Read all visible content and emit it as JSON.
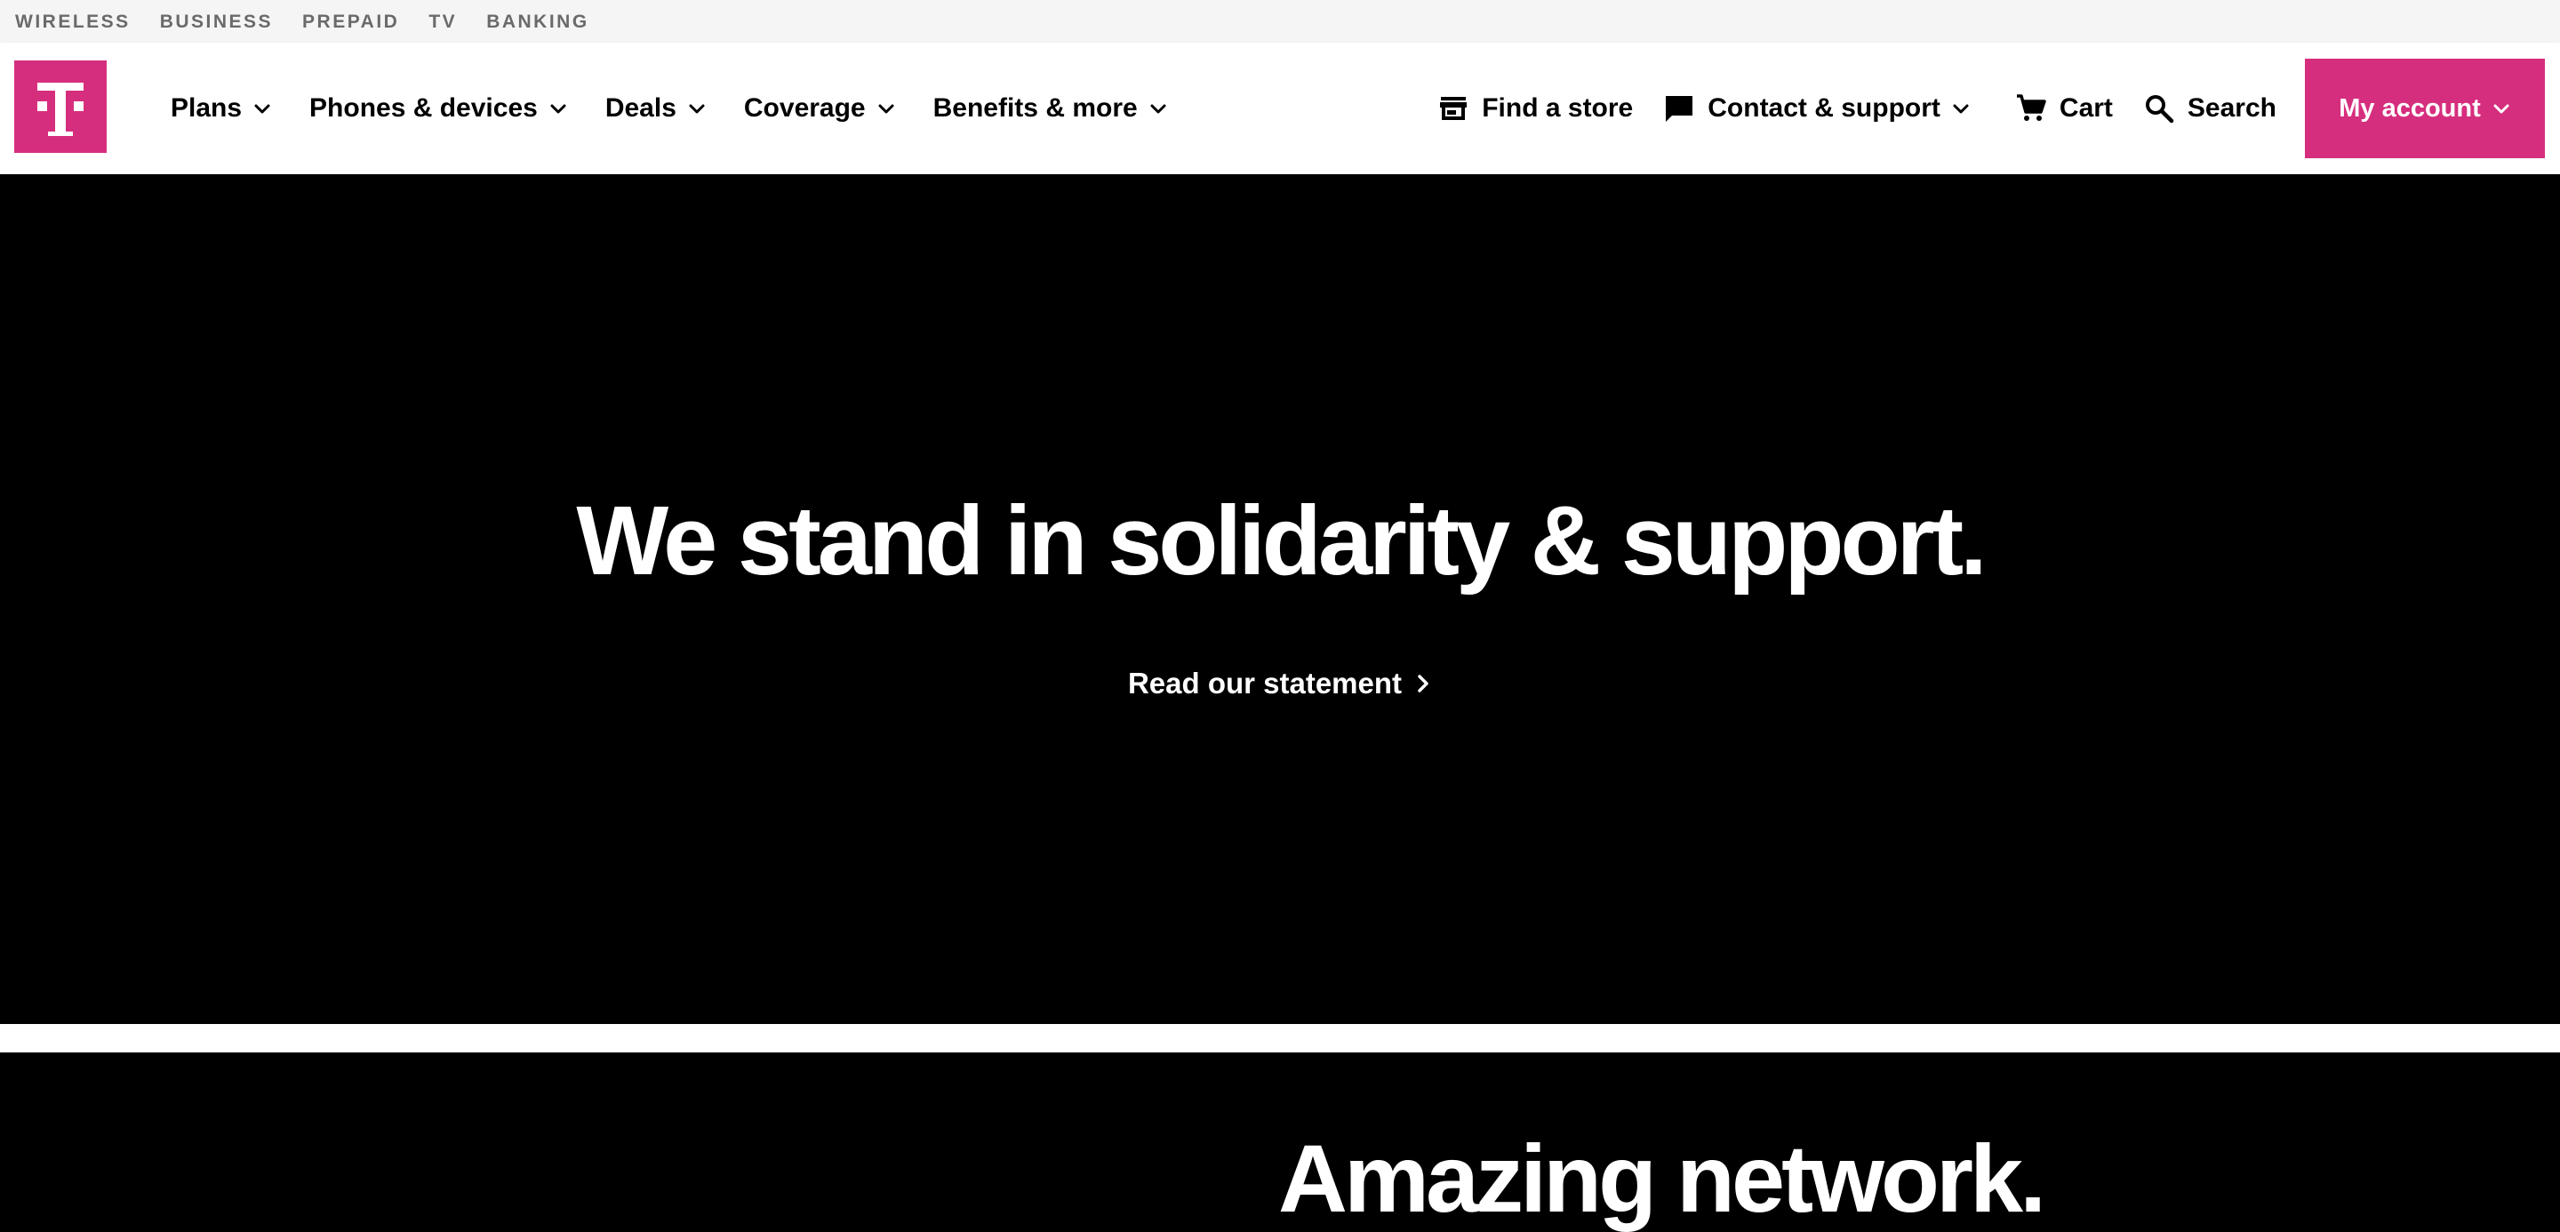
{
  "segments": [
    "WIRELESS",
    "BUSINESS",
    "PREPAID",
    "TV",
    "BANKING"
  ],
  "brand": {
    "logo_letter": "T",
    "accent_color": "#d62e7e"
  },
  "nav": {
    "items": [
      {
        "label": "Plans",
        "icon": "chevron-down-icon"
      },
      {
        "label": "Phones & devices",
        "icon": "chevron-down-icon"
      },
      {
        "label": "Deals",
        "icon": "chevron-down-icon"
      },
      {
        "label": "Coverage",
        "icon": "chevron-down-icon"
      },
      {
        "label": "Benefits & more",
        "icon": "chevron-down-icon"
      }
    ]
  },
  "utility_nav": {
    "find_store": {
      "label": "Find a store",
      "icon": "store-icon"
    },
    "contact": {
      "label": "Contact & support",
      "icon": "chat-icon"
    },
    "cart": {
      "label": "Cart",
      "icon": "cart-icon"
    },
    "search": {
      "label": "Search",
      "icon": "search-icon"
    },
    "account": {
      "label": "My account",
      "icon": "chevron-down-icon"
    }
  },
  "hero": {
    "title": "We stand in solidarity & support.",
    "link_label": "Read our statement",
    "background": "#000000"
  },
  "section_two": {
    "title": "Amazing network."
  }
}
